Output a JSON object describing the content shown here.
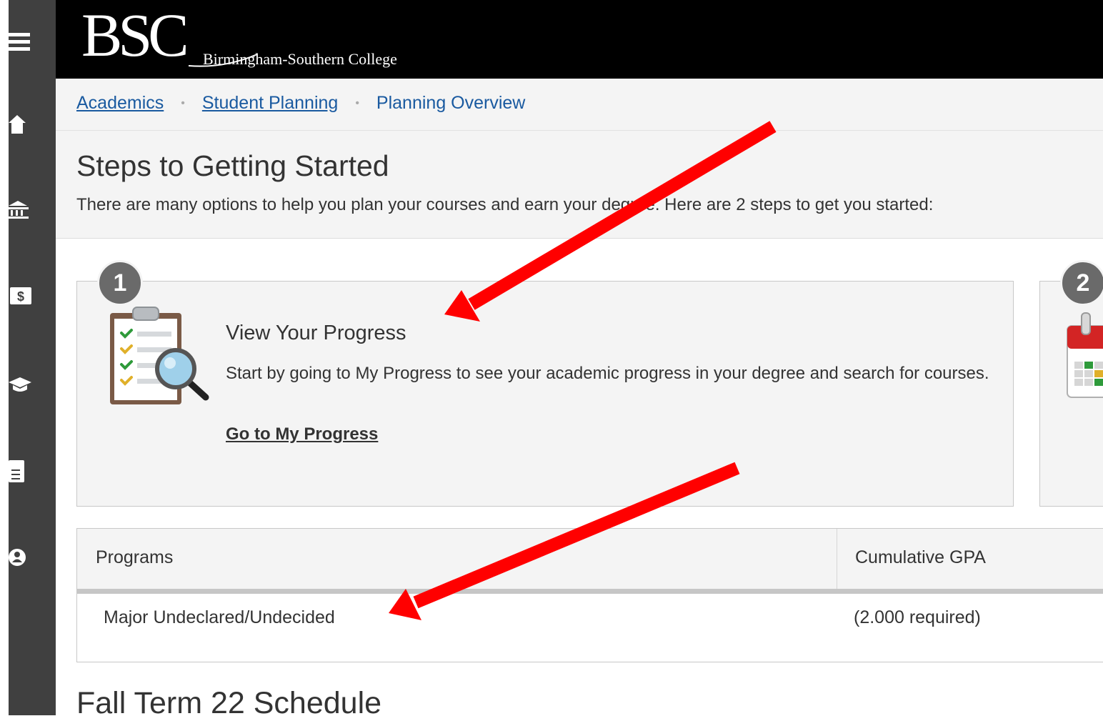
{
  "brand": {
    "logo_text": "BSC",
    "college_name": "Birmingham-Southern College"
  },
  "sidebar": {
    "items": [
      {
        "icon": "menu-icon"
      },
      {
        "icon": "home-icon"
      },
      {
        "icon": "bank-icon"
      },
      {
        "icon": "money-icon"
      },
      {
        "icon": "graduation-cap-icon"
      },
      {
        "icon": "document-icon"
      },
      {
        "icon": "user-icon"
      }
    ]
  },
  "breadcrumb": {
    "items": [
      "Academics",
      "Student Planning",
      "Planning Overview"
    ],
    "separator": "•"
  },
  "steps": {
    "title": "Steps to Getting Started",
    "description": "There are many options to help you plan your courses and earn your degree. Here are 2 steps to get you started:"
  },
  "cards": [
    {
      "number": "1",
      "icon": "clipboard-search-icon",
      "title": "View Your Progress",
      "description": "Start by going to My Progress to see your academic progress in your degree and search for courses.",
      "link": "Go to My Progress"
    },
    {
      "number": "2",
      "icon": "calendar-icon"
    }
  ],
  "programs_table": {
    "headers": [
      "Programs",
      "Cumulative GPA"
    ],
    "rows": [
      [
        "Major Undeclared/Undecided",
        "(2.000 required)"
      ]
    ]
  },
  "schedule": {
    "title": "Fall Term 22 Schedule"
  },
  "colors": {
    "sidebar": "#404040",
    "header": "#000000",
    "link": "#1a5aa0",
    "badge": "#6a6a6a",
    "annotation_arrow": "#ff0000"
  }
}
